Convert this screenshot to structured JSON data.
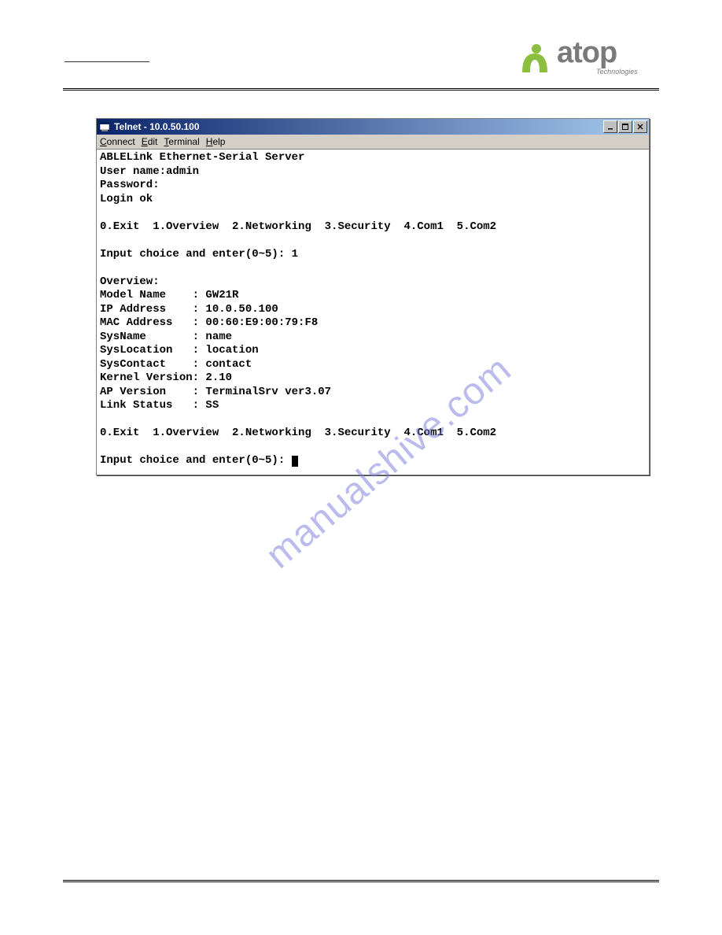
{
  "logo": {
    "brand": "atop",
    "subtext": "Technologies"
  },
  "watermark": "manualshive.com",
  "window": {
    "title": "Telnet - 10.0.50.100",
    "menubar": [
      {
        "accel": "C",
        "rest": "onnect"
      },
      {
        "accel": "E",
        "rest": "dit"
      },
      {
        "accel": "T",
        "rest": "erminal"
      },
      {
        "accel": "H",
        "rest": "elp"
      }
    ],
    "window_buttons": [
      "min",
      "max",
      "close"
    ]
  },
  "terminal": {
    "lines": [
      "ABLELink Ethernet-Serial Server",
      "User name:admin",
      "Password:",
      "Login ok",
      "",
      "0.Exit  1.Overview  2.Networking  3.Security  4.Com1  5.Com2",
      "",
      "Input choice and enter(0~5): 1",
      "",
      "Overview:",
      "Model Name    : GW21R",
      "IP Address    : 10.0.50.100",
      "MAC Address   : 00:60:E9:00:79:F8",
      "SysName       : name",
      "SysLocation   : location",
      "SysContact    : contact",
      "Kernel Version: 2.10",
      "AP Version    : TerminalSrv ver3.07",
      "Link Status   : SS",
      "",
      "0.Exit  1.Overview  2.Networking  3.Security  4.Com1  5.Com2",
      ""
    ],
    "prompt": "Input choice and enter(0~5): "
  }
}
